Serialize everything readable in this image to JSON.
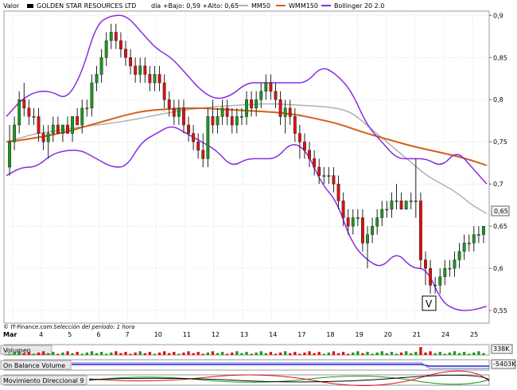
{
  "header": {
    "valor_label": "Valor",
    "instrument": "GOLDEN STAR RESOURCES LTD",
    "day_info": "día +Bajo: 0,59 +Alto: 0,65",
    "legend": [
      {
        "name": "MM50",
        "color": "#b0b0b0"
      },
      {
        "name": "WMM150",
        "color": "#d4601a"
      },
      {
        "name": "Bollinger 20 2.0",
        "color": "#8a2be2"
      }
    ]
  },
  "footer": {
    "copyright": "© IT-Finance.com",
    "period": "Selección del período: 1 hora",
    "x_first": "Mar"
  },
  "marker": {
    "label": "V"
  },
  "colors": {
    "up": "#1a9a1a",
    "down": "#e01010",
    "bollinger": "#8a2be2",
    "mm50": "#b0b0b0",
    "wmm150": "#d4601a",
    "grid": "#c8c8c8",
    "volume_up": "#1a9a1a",
    "volume_down": "#e01010",
    "obv": "#2222cc"
  },
  "chart_data": {
    "type": "candlestick",
    "title": "GOLDEN STAR RESOURCES LTD",
    "ylim": [
      0.535,
      0.905
    ],
    "y_ticks": [
      "0,9",
      "0,85",
      "0,8",
      "0,75",
      "0,7",
      "0,65",
      "0,6",
      "0,55"
    ],
    "x_ticks": [
      "Mar",
      "4",
      "5",
      "6",
      "7",
      "10",
      "11",
      "12",
      "13",
      "14",
      "17",
      "18",
      "19",
      "20",
      "21",
      "24",
      "25"
    ],
    "last_value_label": "0,65",
    "ohlc": [
      [
        0.72,
        0.77,
        0.71,
        0.75
      ],
      [
        0.75,
        0.78,
        0.74,
        0.77
      ],
      [
        0.77,
        0.81,
        0.76,
        0.8
      ],
      [
        0.8,
        0.82,
        0.78,
        0.79
      ],
      [
        0.79,
        0.8,
        0.77,
        0.78
      ],
      [
        0.78,
        0.79,
        0.77,
        0.78
      ],
      [
        0.78,
        0.79,
        0.75,
        0.76
      ],
      [
        0.76,
        0.77,
        0.74,
        0.75
      ],
      [
        0.75,
        0.77,
        0.73,
        0.76
      ],
      [
        0.76,
        0.78,
        0.75,
        0.77
      ],
      [
        0.77,
        0.78,
        0.76,
        0.76
      ],
      [
        0.76,
        0.77,
        0.75,
        0.77
      ],
      [
        0.77,
        0.78,
        0.76,
        0.76
      ],
      [
        0.76,
        0.78,
        0.75,
        0.78
      ],
      [
        0.78,
        0.79,
        0.77,
        0.77
      ],
      [
        0.77,
        0.8,
        0.76,
        0.79
      ],
      [
        0.79,
        0.8,
        0.78,
        0.79
      ],
      [
        0.79,
        0.83,
        0.78,
        0.82
      ],
      [
        0.82,
        0.84,
        0.81,
        0.83
      ],
      [
        0.83,
        0.86,
        0.82,
        0.85
      ],
      [
        0.85,
        0.88,
        0.84,
        0.87
      ],
      [
        0.87,
        0.89,
        0.86,
        0.88
      ],
      [
        0.88,
        0.89,
        0.86,
        0.87
      ],
      [
        0.87,
        0.88,
        0.85,
        0.86
      ],
      [
        0.86,
        0.87,
        0.84,
        0.85
      ],
      [
        0.85,
        0.86,
        0.83,
        0.84
      ],
      [
        0.84,
        0.85,
        0.82,
        0.83
      ],
      [
        0.83,
        0.85,
        0.82,
        0.84
      ],
      [
        0.84,
        0.85,
        0.82,
        0.83
      ],
      [
        0.83,
        0.84,
        0.81,
        0.82
      ],
      [
        0.82,
        0.84,
        0.81,
        0.83
      ],
      [
        0.83,
        0.84,
        0.81,
        0.82
      ],
      [
        0.82,
        0.83,
        0.79,
        0.8
      ],
      [
        0.8,
        0.81,
        0.78,
        0.79
      ],
      [
        0.79,
        0.8,
        0.77,
        0.78
      ],
      [
        0.78,
        0.8,
        0.77,
        0.79
      ],
      [
        0.79,
        0.8,
        0.76,
        0.77
      ],
      [
        0.77,
        0.78,
        0.75,
        0.76
      ],
      [
        0.76,
        0.77,
        0.74,
        0.75
      ],
      [
        0.75,
        0.76,
        0.73,
        0.74
      ],
      [
        0.74,
        0.76,
        0.72,
        0.73
      ],
      [
        0.73,
        0.79,
        0.72,
        0.78
      ],
      [
        0.78,
        0.8,
        0.76,
        0.77
      ],
      [
        0.77,
        0.79,
        0.76,
        0.78
      ],
      [
        0.78,
        0.8,
        0.77,
        0.79
      ],
      [
        0.79,
        0.8,
        0.77,
        0.78
      ],
      [
        0.78,
        0.79,
        0.76,
        0.77
      ],
      [
        0.77,
        0.79,
        0.76,
        0.78
      ],
      [
        0.78,
        0.79,
        0.77,
        0.78
      ],
      [
        0.78,
        0.81,
        0.77,
        0.8
      ],
      [
        0.8,
        0.81,
        0.78,
        0.79
      ],
      [
        0.79,
        0.81,
        0.78,
        0.8
      ],
      [
        0.8,
        0.82,
        0.79,
        0.81
      ],
      [
        0.81,
        0.83,
        0.8,
        0.82
      ],
      [
        0.82,
        0.83,
        0.8,
        0.81
      ],
      [
        0.81,
        0.82,
        0.79,
        0.8
      ],
      [
        0.8,
        0.81,
        0.77,
        0.78
      ],
      [
        0.78,
        0.8,
        0.76,
        0.79
      ],
      [
        0.79,
        0.8,
        0.77,
        0.78
      ],
      [
        0.78,
        0.79,
        0.75,
        0.76
      ],
      [
        0.76,
        0.77,
        0.73,
        0.75
      ],
      [
        0.75,
        0.76,
        0.73,
        0.74
      ],
      [
        0.74,
        0.75,
        0.72,
        0.73
      ],
      [
        0.73,
        0.74,
        0.71,
        0.72
      ],
      [
        0.72,
        0.73,
        0.7,
        0.71
      ],
      [
        0.71,
        0.72,
        0.7,
        0.71
      ],
      [
        0.71,
        0.72,
        0.7,
        0.71
      ],
      [
        0.71,
        0.72,
        0.69,
        0.7
      ],
      [
        0.7,
        0.71,
        0.67,
        0.68
      ],
      [
        0.68,
        0.69,
        0.65,
        0.66
      ],
      [
        0.66,
        0.67,
        0.64,
        0.65
      ],
      [
        0.65,
        0.67,
        0.64,
        0.66
      ],
      [
        0.66,
        0.67,
        0.65,
        0.66
      ],
      [
        0.66,
        0.67,
        0.62,
        0.63
      ],
      [
        0.63,
        0.65,
        0.6,
        0.64
      ],
      [
        0.64,
        0.66,
        0.63,
        0.65
      ],
      [
        0.65,
        0.67,
        0.64,
        0.66
      ],
      [
        0.66,
        0.68,
        0.65,
        0.67
      ],
      [
        0.67,
        0.68,
        0.66,
        0.67
      ],
      [
        0.67,
        0.69,
        0.66,
        0.68
      ],
      [
        0.68,
        0.7,
        0.67,
        0.68
      ],
      [
        0.68,
        0.69,
        0.67,
        0.67
      ],
      [
        0.67,
        0.68,
        0.67,
        0.68
      ],
      [
        0.68,
        0.69,
        0.67,
        0.68
      ],
      [
        0.68,
        0.73,
        0.66,
        0.68
      ],
      [
        0.68,
        0.69,
        0.6,
        0.61
      ],
      [
        0.61,
        0.62,
        0.58,
        0.6
      ],
      [
        0.6,
        0.61,
        0.57,
        0.58
      ],
      [
        0.58,
        0.59,
        0.57,
        0.58
      ],
      [
        0.58,
        0.6,
        0.57,
        0.59
      ],
      [
        0.59,
        0.61,
        0.58,
        0.6
      ],
      [
        0.6,
        0.61,
        0.59,
        0.6
      ],
      [
        0.6,
        0.62,
        0.59,
        0.61
      ],
      [
        0.61,
        0.63,
        0.6,
        0.62
      ],
      [
        0.62,
        0.64,
        0.61,
        0.63
      ],
      [
        0.63,
        0.64,
        0.62,
        0.63
      ],
      [
        0.63,
        0.65,
        0.62,
        0.64
      ],
      [
        0.64,
        0.65,
        0.63,
        0.64
      ],
      [
        0.64,
        0.65,
        0.63,
        0.65
      ]
    ],
    "series": [
      {
        "name": "MM50",
        "values": [
          0.75,
          0.755,
          0.76,
          0.762,
          0.765,
          0.768,
          0.77,
          0.772,
          0.775,
          0.778,
          0.782,
          0.785,
          0.788,
          0.79,
          0.792,
          0.793,
          0.794,
          0.795,
          0.795,
          0.794,
          0.793,
          0.792,
          0.79,
          0.785,
          0.77,
          0.755,
          0.74,
          0.725,
          0.71,
          0.7,
          0.69,
          0.675,
          0.665
        ]
      },
      {
        "name": "WMM150",
        "values": [
          0.75,
          0.752,
          0.755,
          0.758,
          0.762,
          0.767,
          0.772,
          0.777,
          0.782,
          0.786,
          0.788,
          0.789,
          0.79,
          0.79,
          0.789,
          0.788,
          0.787,
          0.786,
          0.785,
          0.783,
          0.78,
          0.776,
          0.772,
          0.766,
          0.76,
          0.755,
          0.75,
          0.745,
          0.741,
          0.737,
          0.733,
          0.728,
          0.722
        ]
      },
      {
        "name": "Bollinger upper",
        "values": [
          0.78,
          0.8,
          0.81,
          0.81,
          0.8,
          0.83,
          0.89,
          0.9,
          0.9,
          0.88,
          0.86,
          0.85,
          0.83,
          0.81,
          0.8,
          0.805,
          0.82,
          0.82,
          0.82,
          0.82,
          0.82,
          0.84,
          0.83,
          0.81,
          0.77,
          0.75,
          0.73,
          0.73,
          0.73,
          0.72,
          0.74,
          0.72,
          0.7
        ]
      },
      {
        "name": "Bollinger lower",
        "values": [
          0.71,
          0.72,
          0.72,
          0.735,
          0.74,
          0.74,
          0.73,
          0.72,
          0.72,
          0.75,
          0.76,
          0.77,
          0.76,
          0.75,
          0.74,
          0.72,
          0.73,
          0.73,
          0.73,
          0.75,
          0.74,
          0.7,
          0.68,
          0.63,
          0.61,
          0.6,
          0.62,
          0.6,
          0.6,
          0.56,
          0.55,
          0.55,
          0.555
        ]
      }
    ],
    "panels": [
      {
        "name": "Volumen",
        "last_value_label": "338K"
      },
      {
        "name": "On Balance Volume",
        "last_value_label": "-5403K"
      },
      {
        "name": "Movimiento Direccional 9"
      }
    ]
  }
}
